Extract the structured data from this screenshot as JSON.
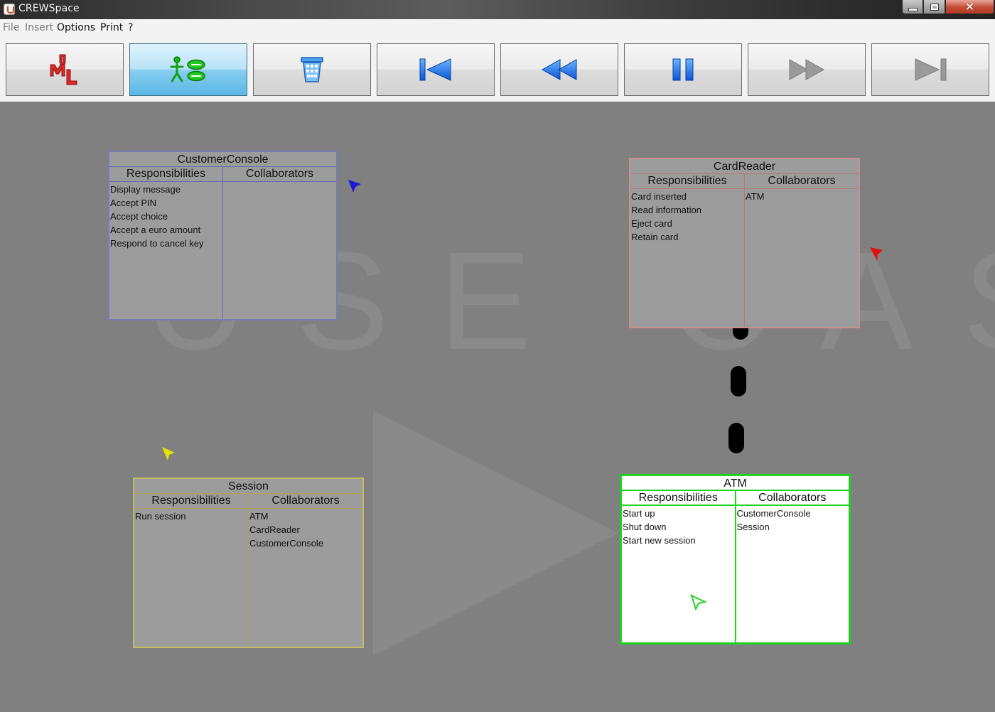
{
  "window": {
    "title": "CREWSpace"
  },
  "menu": {
    "file": "File",
    "insert": "Insert",
    "options": "Options",
    "print": "Print",
    "help": "?"
  },
  "toolbar": {
    "buttons": [
      {
        "name": "uml-button",
        "icon": "uml-icon",
        "active": false,
        "enabled": true
      },
      {
        "name": "use-case-button",
        "icon": "actor-use-case-icon",
        "active": true,
        "enabled": true
      },
      {
        "name": "delete-button",
        "icon": "trash-bin-icon",
        "active": false,
        "enabled": true
      },
      {
        "name": "skip-to-start-button",
        "icon": "skip-start-icon",
        "active": false,
        "enabled": true
      },
      {
        "name": "rewind-button",
        "icon": "rewind-icon",
        "active": false,
        "enabled": true
      },
      {
        "name": "pause-button",
        "icon": "pause-icon",
        "active": false,
        "enabled": true
      },
      {
        "name": "fast-forward-button",
        "icon": "fast-forward-icon",
        "active": false,
        "enabled": false
      },
      {
        "name": "skip-to-end-button",
        "icon": "skip-end-icon",
        "active": false,
        "enabled": false
      }
    ]
  },
  "canvas": {
    "background_text": "USE CASE",
    "cards": {
      "customer_console": {
        "title": "CustomerConsole",
        "responsibilities_label": "Responsibilities",
        "collaborators_label": "Collaborators",
        "responsibilities": [
          "Display message",
          "Accept PIN",
          "Accept choice",
          "Accept a euro amount",
          "Respond to cancel key"
        ],
        "collaborators": [],
        "color": "#7b7bb3"
      },
      "card_reader": {
        "title": "CardReader",
        "responsibilities_label": "Responsibilities",
        "collaborators_label": "Collaborators",
        "responsibilities": [
          "Card inserted",
          "Read information",
          "Eject card",
          "Retain card"
        ],
        "collaborators": [
          "ATM"
        ],
        "color": "#c98f8f"
      },
      "session": {
        "title": "Session",
        "responsibilities_label": "Responsibilities",
        "collaborators_label": "Collaborators",
        "responsibilities": [
          "Run session"
        ],
        "collaborators": [
          "ATM",
          "CardReader",
          "CustomerConsole"
        ],
        "color": "#c2bb63"
      },
      "atm": {
        "title": "ATM",
        "responsibilities_label": "Responsibilities",
        "collaborators_label": "Collaborators",
        "responsibilities": [
          "Start up",
          "Shut down",
          "Start new session"
        ],
        "collaborators": [
          "CustomerConsole",
          "Session"
        ],
        "color": "#1fd31f",
        "selected": true
      }
    },
    "cursors": [
      {
        "name": "blue-user-cursor",
        "color": "#1a1ad6"
      },
      {
        "name": "red-user-cursor",
        "color": "#e01010"
      },
      {
        "name": "yellow-user-cursor",
        "color": "#e8e000"
      },
      {
        "name": "green-user-cursor",
        "color": "#1fd31f"
      }
    ]
  }
}
